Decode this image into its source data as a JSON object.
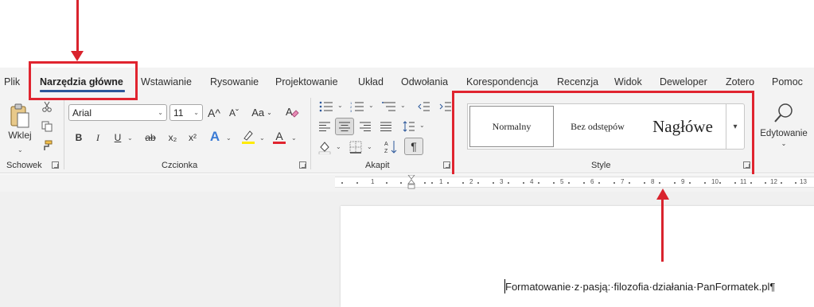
{
  "tabs": [
    {
      "label": "Plik"
    },
    {
      "label": "Narzędzia główne",
      "active": true
    },
    {
      "label": "Wstawianie"
    },
    {
      "label": "Rysowanie"
    },
    {
      "label": "Projektowanie"
    },
    {
      "label": "Układ"
    },
    {
      "label": "Odwołania"
    },
    {
      "label": "Korespondencja"
    },
    {
      "label": "Recenzja"
    },
    {
      "label": "Widok"
    },
    {
      "label": "Deweloper"
    },
    {
      "label": "Zotero"
    },
    {
      "label": "Pomoc"
    }
  ],
  "clipboard": {
    "paste_label": "Wklej",
    "group_label": "Schowek"
  },
  "font": {
    "font_name": "Arial",
    "font_size": "11",
    "grow_label": "A^",
    "shrink_label": "Aˇ",
    "case_label": "Aa",
    "bold": "B",
    "italic": "I",
    "underline": "U",
    "strike": "ab",
    "subscript": "x₂",
    "superscript": "x²",
    "text_effects": "A",
    "font_color": "A",
    "group_label": "Czcionka"
  },
  "paragraph": {
    "group_label": "Akapit",
    "show_marks": "¶"
  },
  "styles": {
    "items": [
      "Normalny",
      "Bez odstępów",
      "Nagłówe"
    ],
    "group_label": "Style"
  },
  "editing": {
    "label": "Edytowanie"
  },
  "ruler": {
    "numbers": [
      "1",
      "2",
      "1",
      "1",
      "2",
      "3",
      "4",
      "5",
      "6",
      "7",
      "8",
      "9",
      "10",
      "11",
      "12",
      "13"
    ]
  },
  "document": {
    "text": "Formatowanie·z·pasją:·filozofia·działania·PanFormatek.pl¶"
  },
  "colors": {
    "accent": "#2b579a",
    "highlight_border": "#e0242f",
    "ribbon_bg": "#f3f3f3"
  },
  "icons": [
    "paste-icon",
    "cut-icon",
    "copy-icon",
    "format-painter-icon",
    "search-icon"
  ]
}
